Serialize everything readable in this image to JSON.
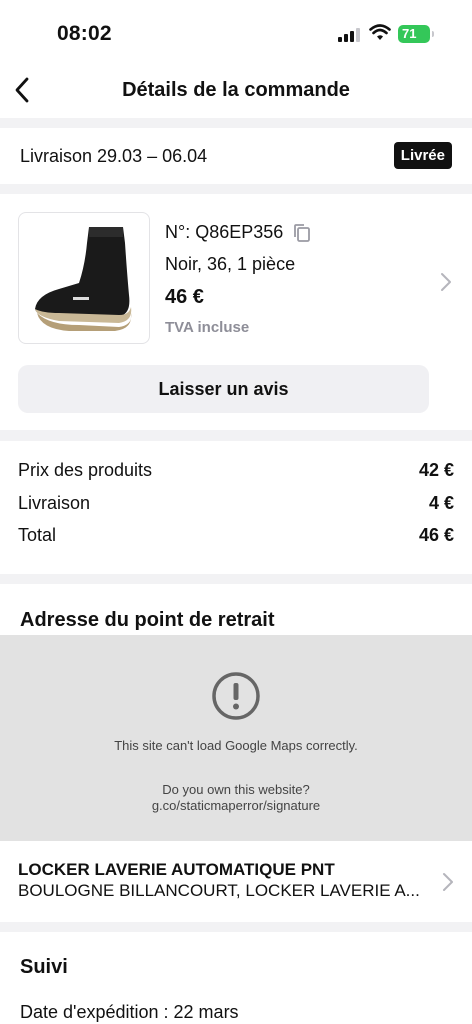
{
  "status_bar": {
    "time": "08:02",
    "battery": "71"
  },
  "header": {
    "title": "Détails de la commande"
  },
  "delivery": {
    "label": "Livraison 29.03 – 06.04",
    "status": "Livrée"
  },
  "product": {
    "order_number": "N°: Q86EP356",
    "variant": "Noir, 36, 1 pièce",
    "price": "46 €",
    "tax_note": "TVA incluse",
    "review_button": "Laisser un avis"
  },
  "summary": {
    "rows": [
      {
        "label": "Prix des produits",
        "value": "42 €"
      },
      {
        "label": "Livraison",
        "value": "4 €"
      },
      {
        "label": "Total",
        "value": "46 €"
      }
    ]
  },
  "pickup": {
    "title": "Adresse du point de retrait",
    "map_error": "This site can't load Google Maps correctly.",
    "map_question": "Do you own this website?",
    "map_link": "g.co/staticmaperror/signature",
    "name": "LOCKER LAVERIE AUTOMATIQUE PNT",
    "address": "BOULOGNE BILLANCOURT, LOCKER LAVERIE A..."
  },
  "tracking": {
    "title": "Suivi",
    "shipping_date": "Date d'expédition : 22 mars"
  },
  "colors": {
    "badge_bg": "#111111",
    "battery": "#34c759",
    "muted": "#8e8e98"
  }
}
